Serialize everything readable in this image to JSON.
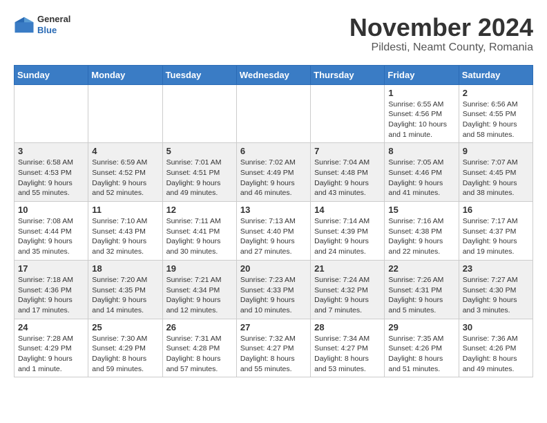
{
  "header": {
    "logo_general": "General",
    "logo_blue": "Blue",
    "month_title": "November 2024",
    "location": "Pildesti, Neamt County, Romania"
  },
  "days_of_week": [
    "Sunday",
    "Monday",
    "Tuesday",
    "Wednesday",
    "Thursday",
    "Friday",
    "Saturday"
  ],
  "weeks": [
    {
      "days": [
        {
          "num": "",
          "info": ""
        },
        {
          "num": "",
          "info": ""
        },
        {
          "num": "",
          "info": ""
        },
        {
          "num": "",
          "info": ""
        },
        {
          "num": "",
          "info": ""
        },
        {
          "num": "1",
          "info": "Sunrise: 6:55 AM\nSunset: 4:56 PM\nDaylight: 10 hours and 1 minute."
        },
        {
          "num": "2",
          "info": "Sunrise: 6:56 AM\nSunset: 4:55 PM\nDaylight: 9 hours and 58 minutes."
        }
      ]
    },
    {
      "days": [
        {
          "num": "3",
          "info": "Sunrise: 6:58 AM\nSunset: 4:53 PM\nDaylight: 9 hours and 55 minutes."
        },
        {
          "num": "4",
          "info": "Sunrise: 6:59 AM\nSunset: 4:52 PM\nDaylight: 9 hours and 52 minutes."
        },
        {
          "num": "5",
          "info": "Sunrise: 7:01 AM\nSunset: 4:51 PM\nDaylight: 9 hours and 49 minutes."
        },
        {
          "num": "6",
          "info": "Sunrise: 7:02 AM\nSunset: 4:49 PM\nDaylight: 9 hours and 46 minutes."
        },
        {
          "num": "7",
          "info": "Sunrise: 7:04 AM\nSunset: 4:48 PM\nDaylight: 9 hours and 43 minutes."
        },
        {
          "num": "8",
          "info": "Sunrise: 7:05 AM\nSunset: 4:46 PM\nDaylight: 9 hours and 41 minutes."
        },
        {
          "num": "9",
          "info": "Sunrise: 7:07 AM\nSunset: 4:45 PM\nDaylight: 9 hours and 38 minutes."
        }
      ]
    },
    {
      "days": [
        {
          "num": "10",
          "info": "Sunrise: 7:08 AM\nSunset: 4:44 PM\nDaylight: 9 hours and 35 minutes."
        },
        {
          "num": "11",
          "info": "Sunrise: 7:10 AM\nSunset: 4:43 PM\nDaylight: 9 hours and 32 minutes."
        },
        {
          "num": "12",
          "info": "Sunrise: 7:11 AM\nSunset: 4:41 PM\nDaylight: 9 hours and 30 minutes."
        },
        {
          "num": "13",
          "info": "Sunrise: 7:13 AM\nSunset: 4:40 PM\nDaylight: 9 hours and 27 minutes."
        },
        {
          "num": "14",
          "info": "Sunrise: 7:14 AM\nSunset: 4:39 PM\nDaylight: 9 hours and 24 minutes."
        },
        {
          "num": "15",
          "info": "Sunrise: 7:16 AM\nSunset: 4:38 PM\nDaylight: 9 hours and 22 minutes."
        },
        {
          "num": "16",
          "info": "Sunrise: 7:17 AM\nSunset: 4:37 PM\nDaylight: 9 hours and 19 minutes."
        }
      ]
    },
    {
      "days": [
        {
          "num": "17",
          "info": "Sunrise: 7:18 AM\nSunset: 4:36 PM\nDaylight: 9 hours and 17 minutes."
        },
        {
          "num": "18",
          "info": "Sunrise: 7:20 AM\nSunset: 4:35 PM\nDaylight: 9 hours and 14 minutes."
        },
        {
          "num": "19",
          "info": "Sunrise: 7:21 AM\nSunset: 4:34 PM\nDaylight: 9 hours and 12 minutes."
        },
        {
          "num": "20",
          "info": "Sunrise: 7:23 AM\nSunset: 4:33 PM\nDaylight: 9 hours and 10 minutes."
        },
        {
          "num": "21",
          "info": "Sunrise: 7:24 AM\nSunset: 4:32 PM\nDaylight: 9 hours and 7 minutes."
        },
        {
          "num": "22",
          "info": "Sunrise: 7:26 AM\nSunset: 4:31 PM\nDaylight: 9 hours and 5 minutes."
        },
        {
          "num": "23",
          "info": "Sunrise: 7:27 AM\nSunset: 4:30 PM\nDaylight: 9 hours and 3 minutes."
        }
      ]
    },
    {
      "days": [
        {
          "num": "24",
          "info": "Sunrise: 7:28 AM\nSunset: 4:29 PM\nDaylight: 9 hours and 1 minute."
        },
        {
          "num": "25",
          "info": "Sunrise: 7:30 AM\nSunset: 4:29 PM\nDaylight: 8 hours and 59 minutes."
        },
        {
          "num": "26",
          "info": "Sunrise: 7:31 AM\nSunset: 4:28 PM\nDaylight: 8 hours and 57 minutes."
        },
        {
          "num": "27",
          "info": "Sunrise: 7:32 AM\nSunset: 4:27 PM\nDaylight: 8 hours and 55 minutes."
        },
        {
          "num": "28",
          "info": "Sunrise: 7:34 AM\nSunset: 4:27 PM\nDaylight: 8 hours and 53 minutes."
        },
        {
          "num": "29",
          "info": "Sunrise: 7:35 AM\nSunset: 4:26 PM\nDaylight: 8 hours and 51 minutes."
        },
        {
          "num": "30",
          "info": "Sunrise: 7:36 AM\nSunset: 4:26 PM\nDaylight: 8 hours and 49 minutes."
        }
      ]
    }
  ]
}
